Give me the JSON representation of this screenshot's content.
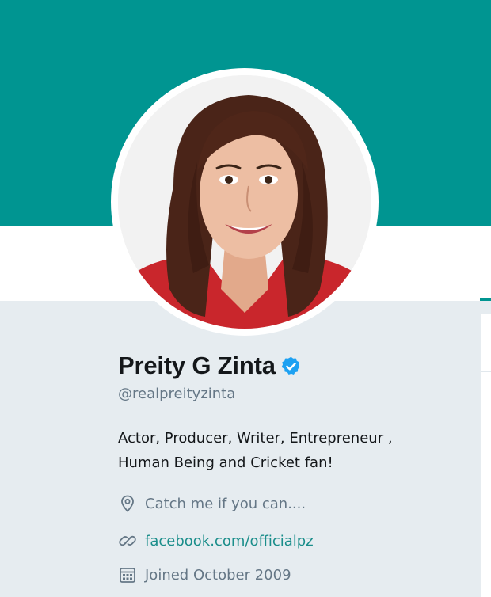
{
  "colors": {
    "banner": "#009591",
    "page_background": "#e6ecf0",
    "link": "#1b8e8b",
    "verified_badge": "#1da1f2",
    "muted_text": "#657786"
  },
  "profile": {
    "name": "Preity G Zinta",
    "verified": true,
    "handle": "@realpreityzinta",
    "bio_line1": "Actor, Producer, Writer, Entrepreneur ,",
    "bio_line2": "Human Being and Cricket fan!",
    "location": "Catch me if you can....",
    "website": "facebook.com/officialpz",
    "joined": "Joined October 2009"
  },
  "icons": {
    "verified": "verified-badge-icon",
    "location": "location-pin-icon",
    "website": "link-icon",
    "joined": "calendar-icon"
  }
}
